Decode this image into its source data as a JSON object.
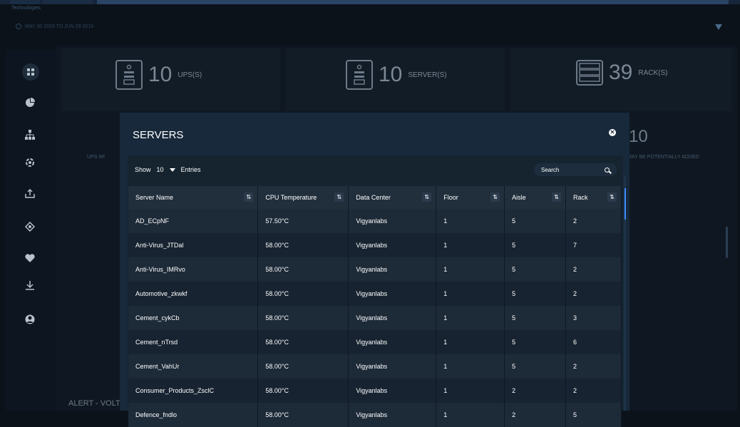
{
  "app": {
    "brand": "Technologies",
    "date_range": "MAY 30 2019 TO JUN 29 2019",
    "background_text": {
      "alert": "ALERT - VOLT",
      "ups_with": "UPS WI",
      "may_be_added": "MAY BE POTENTIALLY ADDED",
      "extra_count": "10"
    }
  },
  "stats": [
    {
      "value": "10",
      "label": "UPS(S)"
    },
    {
      "value": "10",
      "label": "SERVER(S)"
    },
    {
      "value": "39",
      "label": "RACK(S)"
    }
  ],
  "modal": {
    "title": "SERVERS",
    "close_icon": "close-circle-icon",
    "show_label": "Show",
    "entries_value": "10",
    "entries_label": "Entries",
    "search_placeholder": "Search",
    "columns": [
      "Server Name",
      "CPU Temperature",
      "Data Center",
      "Floor",
      "Aisle",
      "Rack"
    ],
    "sort_glyph": "⇅",
    "rows": [
      [
        "AD_ECpNF",
        "57.50°C",
        "Vigyanlabs",
        "1",
        "5",
        "2"
      ],
      [
        "Anti-Virus_JTDal",
        "58.00°C",
        "Vigyanlabs",
        "1",
        "5",
        "7"
      ],
      [
        "Anti-Virus_IMRvo",
        "58.00°C",
        "Vigyanlabs",
        "1",
        "5",
        "2"
      ],
      [
        "Automotive_zkwkf",
        "58.00°C",
        "Vigyanlabs",
        "1",
        "5",
        "2"
      ],
      [
        "Cement_cykCb",
        "58.00°C",
        "Vigyanlabs",
        "1",
        "5",
        "3"
      ],
      [
        "Cement_nTrsd",
        "58.00°C",
        "Vigyanlabs",
        "1",
        "5",
        "6"
      ],
      [
        "Cement_VahUr",
        "58.00°C",
        "Vigyanlabs",
        "1",
        "5",
        "2"
      ],
      [
        "Consumer_Products_ZsclC",
        "58.00°C",
        "Vigyanlabs",
        "1",
        "2",
        "2"
      ],
      [
        "Defence_fndlo",
        "58.00°C",
        "Vigyanlabs",
        "1",
        "2",
        "5"
      ]
    ]
  },
  "sidebar_icons": [
    "dashboard-icon",
    "pie-chart-icon",
    "hierarchy-icon",
    "settings-cycle-icon",
    "upload-icon",
    "refresh-icon",
    "heartbeat-icon",
    "download-icon",
    "user-icon"
  ],
  "colors": {
    "accent": "#3d8cff",
    "modal_bg": "#17293b",
    "page_bg": "#0b1219"
  }
}
